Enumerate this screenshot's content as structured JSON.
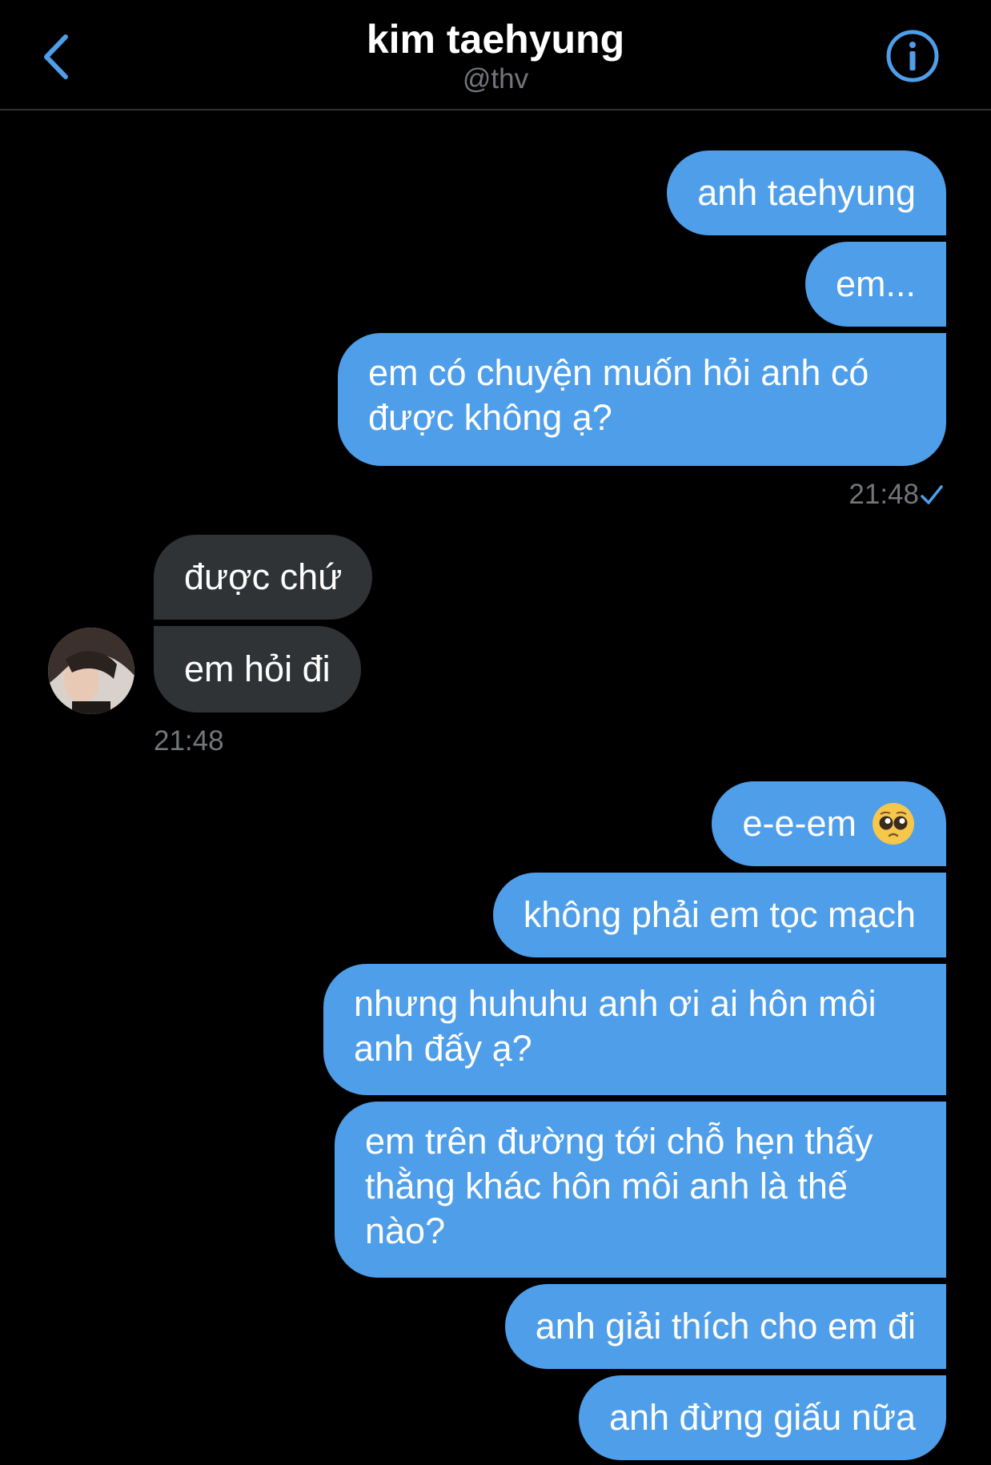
{
  "header": {
    "title": "kim taehyung",
    "handle": "@thv"
  },
  "messages": [
    {
      "side": "out",
      "text": "anh taehyung"
    },
    {
      "side": "out",
      "text": "em..."
    },
    {
      "side": "out",
      "text": "em có chuyện muốn hỏi anh có\nđược không ạ?"
    },
    {
      "side": "in",
      "text": "được chứ"
    },
    {
      "side": "in",
      "text": "em hỏi đi"
    },
    {
      "side": "out",
      "text": "e-e-em",
      "emoji": "pleading-face-emoji"
    },
    {
      "side": "out",
      "text": "không phải em tọc mạch"
    },
    {
      "side": "out",
      "text": "nhưng huhuhu anh ơi ai hôn môi\nanh đấy ạ?"
    },
    {
      "side": "out",
      "text": "em trên đường tới chỗ hẹn thấy\nthằng khác hôn môi anh là thế\nnào?"
    },
    {
      "side": "out",
      "text": "anh giải thích cho em đi"
    },
    {
      "side": "out",
      "text": "anh đừng giấu nữa"
    }
  ],
  "timestamps": {
    "out_group_1": "21:48",
    "in_group_1": "21:48"
  },
  "icons": {
    "back": "chevron-left-icon",
    "info": "info-circle-icon",
    "read": "checkmark-icon",
    "avatar": "avatar"
  },
  "colors": {
    "background": "#000000",
    "accent": "#4f9ee9",
    "incoming_bubble": "#2f3336",
    "muted_text": "#71767b"
  }
}
